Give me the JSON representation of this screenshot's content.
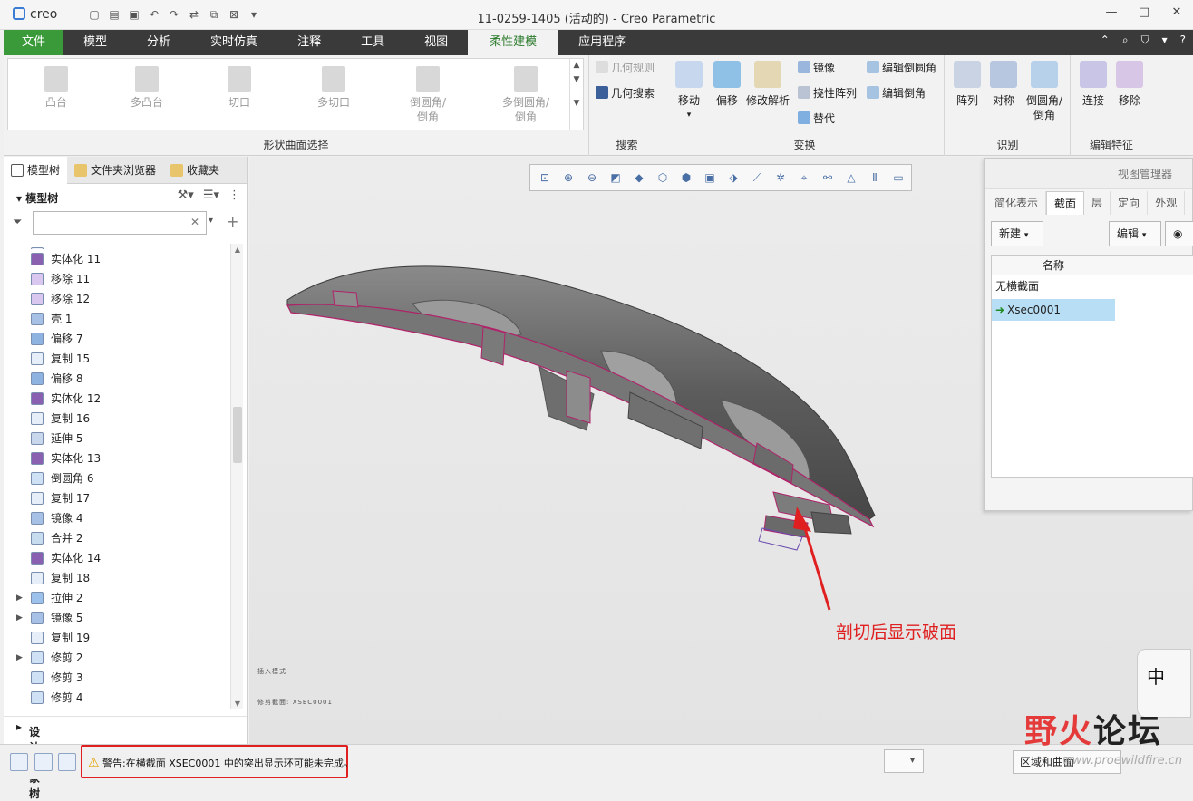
{
  "app": {
    "logo": "creo",
    "window_title": "11-0259-1405 (活动的) - Creo Parametric"
  },
  "tabs": [
    "文件",
    "模型",
    "分析",
    "实时仿真",
    "注释",
    "工具",
    "视图",
    "柔性建模",
    "应用程序"
  ],
  "ribbon": {
    "shape_group": {
      "title": "形状曲面选择",
      "items": [
        "凸台",
        "多凸台",
        "切口",
        "多切口",
        "倒圆角/\n倒角",
        "多倒圆角/\n倒角"
      ]
    },
    "search_group": {
      "title": "搜索",
      "geom_rules": "几何规则",
      "geom_search": "几何搜索"
    },
    "transform_group": {
      "title": "变换",
      "move": "移动",
      "offset": "偏移",
      "modify_analytic": "修改解析",
      "mirror": "镜像",
      "flex_pattern": "挠性阵列",
      "substitute": "替代",
      "edit_round": "编辑倒圆角",
      "edit_chamfer": "编辑倒角"
    },
    "recognize_group": {
      "title": "识别",
      "pattern": "阵列",
      "symmetry": "对称",
      "round_chamfer": "倒圆角/\n倒角"
    },
    "edit_feature_group": {
      "title": "编辑特征",
      "attach": "连接",
      "remove": "移除"
    }
  },
  "navigator": {
    "tabs": [
      "模型树",
      "文件夹浏览器",
      "收藏夹"
    ],
    "tree_title": "模型树",
    "filter_placeholder": "",
    "items": [
      {
        "label": "实体化 11",
        "expand": ""
      },
      {
        "label": "移除 11",
        "expand": ""
      },
      {
        "label": "移除 12",
        "expand": ""
      },
      {
        "label": "壳 1",
        "expand": ""
      },
      {
        "label": "偏移 7",
        "expand": ""
      },
      {
        "label": "复制 15",
        "expand": ""
      },
      {
        "label": "偏移 8",
        "expand": ""
      },
      {
        "label": "实体化 12",
        "expand": ""
      },
      {
        "label": "复制 16",
        "expand": ""
      },
      {
        "label": "延伸 5",
        "expand": ""
      },
      {
        "label": "实体化 13",
        "expand": ""
      },
      {
        "label": "倒圆角 6",
        "expand": ""
      },
      {
        "label": "复制 17",
        "expand": ""
      },
      {
        "label": "镜像 4",
        "expand": ""
      },
      {
        "label": "合并 2",
        "expand": ""
      },
      {
        "label": "实体化 14",
        "expand": ""
      },
      {
        "label": "复制 18",
        "expand": ""
      },
      {
        "label": "拉伸 2",
        "expand": "▶"
      },
      {
        "label": "镜像 5",
        "expand": "▶"
      },
      {
        "label": "复制 19",
        "expand": ""
      },
      {
        "label": "修剪 2",
        "expand": "▶"
      },
      {
        "label": "修剪 3",
        "expand": ""
      },
      {
        "label": "修剪 4",
        "expand": ""
      }
    ],
    "design_tree": "设计对象树"
  },
  "graphics": {
    "annotation": "剖切后显示破面",
    "tiny_text_1": "插入模式",
    "tiny_text_2": "修剪截面: XSEC0001"
  },
  "view_manager": {
    "title": "视图管理器",
    "tabs": [
      "简化表示",
      "截面",
      "层",
      "定向",
      "外观"
    ],
    "new_button": "新建",
    "edit_button": "编辑",
    "column": "名称",
    "rows": [
      "无横截面",
      "Xsec0001"
    ]
  },
  "status": {
    "warning": "警告:在横截面 XSEC0001 中的突出显示环可能未完成。",
    "filter_button": "区域和曲面"
  },
  "watermark": {
    "text_red": "野火",
    "text_dark": "论坛",
    "url": "www.proewildfire.cn"
  },
  "ime": {
    "label": "中"
  },
  "colors": {
    "file_tab": "#3a9a3a",
    "active_tab_text": "#2a7a2a",
    "annotation": "#e02020",
    "selection": "#b8def5"
  }
}
